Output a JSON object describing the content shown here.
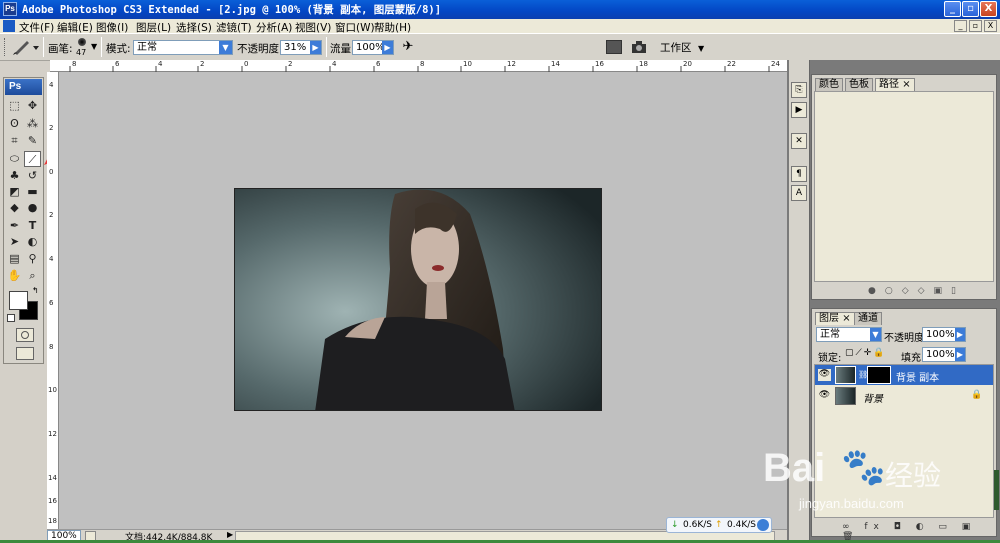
{
  "titlebar": {
    "logo": "Ps",
    "title": "Adobe Photoshop CS3 Extended - [2.jpg @ 100% (背景 副本, 图层蒙版/8)]",
    "buttons": [
      "_",
      "▫",
      "X"
    ]
  },
  "menu": {
    "items": [
      "文件(F)",
      "编辑(E)",
      "图像(I)",
      "图层(L)",
      "选择(S)",
      "滤镜(T)",
      "分析(A)",
      "视图(V)",
      "窗口(W)",
      "帮助(H)"
    ],
    "doc_buttons": [
      "_",
      "▫",
      "X"
    ]
  },
  "options": {
    "brush_label": "画笔:",
    "brush_size": "47",
    "mode_label": "模式:",
    "mode_value": "正常",
    "opacity_label": "不透明度:",
    "opacity_value": "31%",
    "flow_label": "流量:",
    "flow_value": "100%",
    "workspace_label": "工作区"
  },
  "toolbox": {
    "header": "Ps"
  },
  "ruler": {
    "h_ticks": [
      "8",
      "6",
      "4",
      "2",
      "0",
      "2",
      "4",
      "6",
      "8",
      "10",
      "12",
      "14",
      "16",
      "18",
      "20",
      "22",
      "24"
    ],
    "v_ticks": [
      "4",
      "2",
      "0",
      "2",
      "4",
      "6",
      "8",
      "10",
      "12",
      "14",
      "16",
      "18"
    ]
  },
  "status": {
    "zoom": "100%",
    "doc": "文档:442.4K/884.8K"
  },
  "network": {
    "down": "0.6K/S",
    "up": "0.4K/S"
  },
  "panel_top": {
    "tabs": [
      "颜色",
      "色板",
      "路径"
    ]
  },
  "layers_panel": {
    "tabs": [
      "图层",
      "通道"
    ],
    "blend": "正常",
    "opacity_label": "不透明度:",
    "opacity": "100%",
    "lock_label": "锁定:",
    "fill_label": "填充:",
    "fill": "100%",
    "layers": [
      {
        "name": "背景 副本",
        "selected": true
      },
      {
        "name": "背景",
        "selected": false
      }
    ]
  },
  "watermark": {
    "brand": "Bai",
    "brand2": "经验",
    "url": "jingyan.baidu.com"
  },
  "colors": {
    "accent": "#316ac5",
    "arrow": "#e53a3a"
  }
}
